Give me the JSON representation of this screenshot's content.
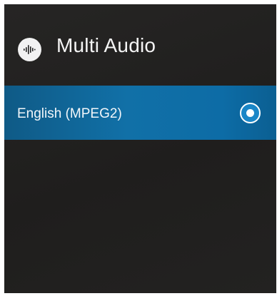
{
  "dialog": {
    "title": "Multi Audio",
    "icon": "audio-waveform-icon"
  },
  "options": [
    {
      "label": "English (MPEG2)",
      "selected": true
    }
  ],
  "colors": {
    "background": "#232221",
    "selection": "#1170a7",
    "text": "#f4f4f4"
  }
}
